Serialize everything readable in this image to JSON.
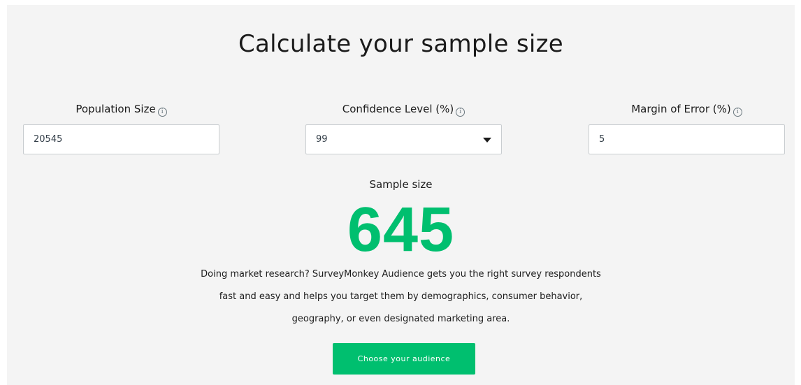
{
  "page": {
    "title": "Calculate your sample size"
  },
  "fields": {
    "population": {
      "label": "Population Size",
      "value": "20545",
      "info_icon": "info-icon"
    },
    "confidence": {
      "label": "Confidence Level (%)",
      "value": "99",
      "info_icon": "info-icon",
      "dropdown_icon": "caret-down-icon"
    },
    "margin": {
      "label": "Margin of Error (%)",
      "value": "5",
      "info_icon": "info-icon"
    }
  },
  "result": {
    "label": "Sample size",
    "value": "645"
  },
  "description": "Doing market research? SurveyMonkey Audience gets you the right survey respondents fast and easy and helps you target them by demographics, consumer behavior, geography, or even designated marketing area.",
  "cta": {
    "label": "Choose your audience"
  },
  "colors": {
    "accent": "#00bf6f",
    "panel_background": "#f4f4f4",
    "text": "#1b1b1b"
  }
}
